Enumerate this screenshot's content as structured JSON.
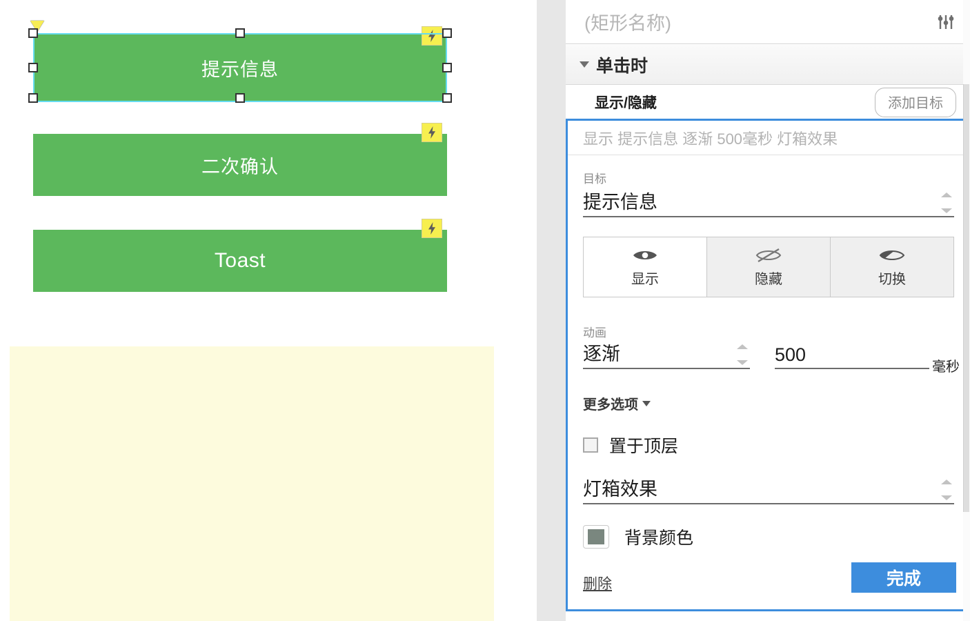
{
  "canvas": {
    "shapes": [
      {
        "label": "提示信息",
        "selected": true,
        "has_interaction_badge": true
      },
      {
        "label": "二次确认",
        "selected": false,
        "has_interaction_badge": true
      },
      {
        "label": "Toast",
        "selected": false,
        "has_interaction_badge": true
      }
    ],
    "shape_fill_color": "#5cb85c",
    "selection_outline_color": "#66dcf0",
    "interaction_badge_color": "#f7ef4f",
    "interaction_badge_icon": "lightning-bolt-icon",
    "rotation_marker_icon": "triangle-marker-icon",
    "note_region_color": "#fdfbdd"
  },
  "panel": {
    "shape_name_placeholder": "(矩形名称)",
    "options_icon": "sliders-icon",
    "event": {
      "title": "单击时",
      "expanded": true,
      "disclosure_icon": "triangle-down-icon"
    },
    "case": {
      "label": "显示/隐藏",
      "add_target_label": "添加目标"
    },
    "editor": {
      "summary": "显示 提示信息 逐渐 500毫秒 灯箱效果",
      "target": {
        "label": "目标",
        "value": "提示信息",
        "stepper_icon": "stepper-updown-icon"
      },
      "visibility": {
        "options": [
          {
            "label": "显示",
            "icon": "eye-open-icon",
            "active": true
          },
          {
            "label": "隐藏",
            "icon": "eye-slash-icon",
            "active": false
          },
          {
            "label": "切换",
            "icon": "eye-toggle-icon",
            "active": false
          }
        ]
      },
      "animation": {
        "label": "动画",
        "value": "逐渐",
        "duration": "500",
        "duration_unit": "毫秒",
        "stepper_icon": "stepper-updown-icon"
      },
      "more_options": {
        "label": "更多选项",
        "caret_icon": "triangle-down-icon"
      },
      "bring_to_front": {
        "label": "置于顶层",
        "checked": false
      },
      "lightbox": {
        "value": "灯箱效果",
        "stepper_icon": "stepper-updown-icon"
      },
      "background_color": {
        "label": "背景颜色",
        "swatch_color": "#7a877f"
      },
      "delete_label": "删除",
      "done_label": "完成",
      "accent_color": "#3d8ddd"
    }
  }
}
